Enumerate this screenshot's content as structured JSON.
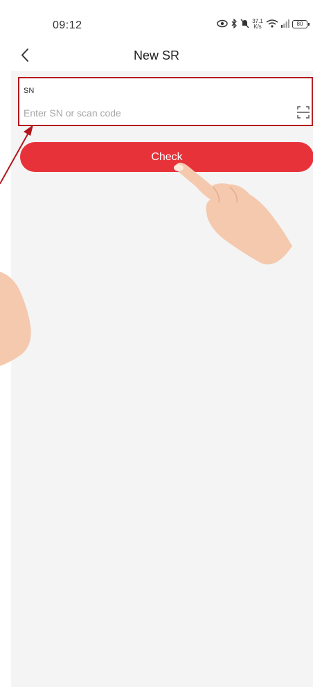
{
  "status_bar": {
    "time": "09:12",
    "network_speed_value": "37.1",
    "network_speed_unit": "K/s",
    "battery": "80"
  },
  "header": {
    "title": "New SR",
    "back_icon": "chevron-left-icon"
  },
  "sn_field": {
    "label": "SN",
    "placeholder": "Enter SN or scan code",
    "value": "",
    "scan_icon": "scan-code-icon"
  },
  "actions": {
    "check_label": "Check"
  },
  "colors": {
    "primary_red": "#e8323a",
    "highlight_border": "#b3151c",
    "annotation_arrow": "#b3151c",
    "background_grey": "#f4f4f4",
    "hand_skin": "#f4c9ae"
  }
}
